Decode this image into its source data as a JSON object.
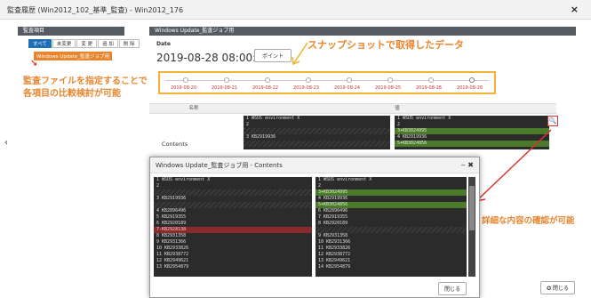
{
  "window": {
    "title": "監査履歴 (Win2012_102_基準_監査) - Win2012_176",
    "close": "×"
  },
  "left": {
    "header": "監査項目",
    "tabs": [
      "すべて",
      "未変更",
      "変 更",
      "追 加",
      "削 除"
    ],
    "selected_item": "Windows Update_監査ジョブ用",
    "annotation_line1": "監査ファイルを指定することで",
    "annotation_line2": "各項目の比較検討が可能",
    "arrow": "↘",
    "nav": "‹"
  },
  "main": {
    "header": "Windows Update_監査ジョブ用",
    "date_label": "Date",
    "date_value": "2019-08-28 08:00:00",
    "point_button": "ポイント",
    "snapshot_annotation": "スナップショットで取得したデータ",
    "timeline_dates": [
      "2019-08-20",
      "2019-08-21",
      "2019-08-22",
      "2019-08-23",
      "2019-08-24",
      "2019-08-25",
      "2019-08-26",
      "2019-08-28"
    ],
    "col_name": "名称",
    "col_value": "値",
    "row_label": "Contents",
    "zoom_icon": "🔍",
    "detail_annotation": "詳細な内容の確認が可能",
    "left_code": [
      {
        "t": "1 WSUS environment X",
        "c": ""
      },
      {
        "t": "2",
        "c": ""
      },
      {
        "t": "",
        "c": "hatch"
      },
      {
        "t": "3 KB2919936",
        "c": ""
      },
      {
        "t": "",
        "c": "hatch"
      }
    ],
    "right_code": [
      {
        "t": "1 WSUS environment X",
        "c": ""
      },
      {
        "t": "2",
        "c": ""
      },
      {
        "t": "3+KB3024995",
        "c": "add"
      },
      {
        "t": "4 KB2919936",
        "c": ""
      },
      {
        "t": "5+KB3024856",
        "c": "add"
      }
    ]
  },
  "modal": {
    "title": "Windows Update_監査ジョブ用 - Contents",
    "controls": "‒ ✖",
    "left_code": [
      {
        "t": "1 WSUS environment X",
        "c": ""
      },
      {
        "t": "2",
        "c": ""
      },
      {
        "t": "",
        "c": "hatch"
      },
      {
        "t": "3 KB2919936",
        "c": ""
      },
      {
        "t": "",
        "c": "hatch"
      },
      {
        "t": "4 KB2896496",
        "c": ""
      },
      {
        "t": "5 KB2919355",
        "c": ""
      },
      {
        "t": "6 KB2920189",
        "c": ""
      },
      {
        "t": "7-KB2928138",
        "c": "del"
      },
      {
        "t": "8 KB2931358",
        "c": ""
      },
      {
        "t": "9 KB2931366",
        "c": ""
      },
      {
        "t": "10 KB2933826",
        "c": ""
      },
      {
        "t": "11 KB2938772",
        "c": ""
      },
      {
        "t": "12 KB2949621",
        "c": ""
      },
      {
        "t": "13 KB2954879",
        "c": ""
      }
    ],
    "right_code": [
      {
        "t": "1 WSUS environment X",
        "c": ""
      },
      {
        "t": "2",
        "c": ""
      },
      {
        "t": "3+KB3024995",
        "c": "add"
      },
      {
        "t": "4 KB2919936",
        "c": ""
      },
      {
        "t": "5+KB3024856",
        "c": "add"
      },
      {
        "t": "6 KB2896496",
        "c": ""
      },
      {
        "t": "7 KB2919355",
        "c": ""
      },
      {
        "t": "8 KB2920189",
        "c": ""
      },
      {
        "t": "",
        "c": "hatch"
      },
      {
        "t": "9 KB2931358",
        "c": ""
      },
      {
        "t": "10 KB2931366",
        "c": ""
      },
      {
        "t": "11 KB2933826",
        "c": ""
      },
      {
        "t": "12 KB2938772",
        "c": ""
      },
      {
        "t": "13 KB2949621",
        "c": ""
      },
      {
        "t": "14 KB2954879",
        "c": ""
      }
    ],
    "close_button": "閉じる"
  },
  "footer": {
    "close_button": "✪ 閉じる"
  },
  "colors": {
    "accent_orange": "#e8862f",
    "timeline_border": "#f2b233",
    "arrow_red": "#d9342b",
    "tab_active": "#1f6fb5"
  }
}
